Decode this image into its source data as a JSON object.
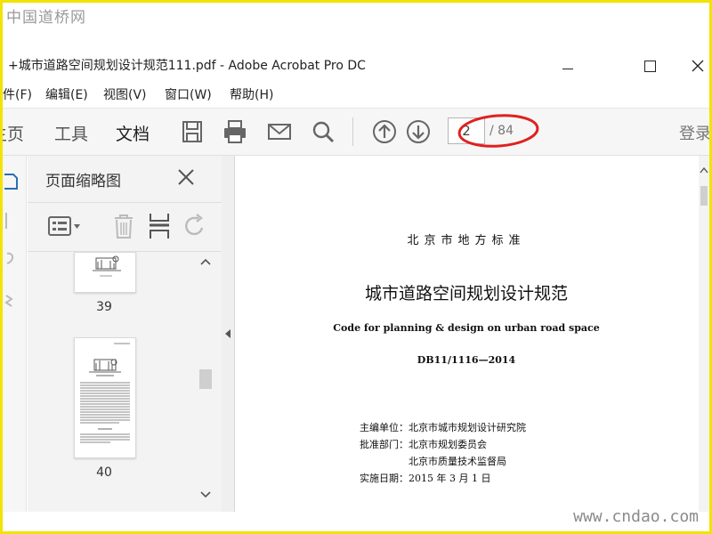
{
  "watermarks": {
    "top": "中国道桥网",
    "bottom": "www.cndao.com"
  },
  "window": {
    "title": "+城市道路空间规划设计规范111.pdf - Adobe Acrobat Pro DC",
    "min": "–",
    "max": "□",
    "close": "✕"
  },
  "menu": [
    "件(F)",
    "编辑(E)",
    "视图(V)",
    "窗口(W)",
    "帮助(H)"
  ],
  "toolbar": {
    "tabs": [
      "主页",
      "工具",
      "文档"
    ],
    "active_tab": "文档",
    "icons": [
      "save-icon",
      "print-icon",
      "email-icon",
      "search-icon",
      "page-up-icon",
      "page-down-icon"
    ],
    "page_current": "2",
    "page_total": "/ 84",
    "login": "登录",
    "highlight_color": "#e02020"
  },
  "panel": {
    "title": "页面缩略图",
    "tools": [
      "thumbnail-options-icon",
      "delete-icon",
      "insert-icon",
      "rotate-icon"
    ],
    "thumbnails": [
      {
        "label": "39"
      },
      {
        "label": "40"
      }
    ]
  },
  "document": {
    "standard_type": "北京市地方标准",
    "title": "城市道路空间规划设计规范",
    "title_en": "Code for planning & design on urban road space",
    "code": "DB11/1116—2014",
    "meta": [
      "主编单位：北京市城市规划设计研究院",
      "批准部门：北京市规划委员会",
      "　　　　　北京市质量技术监督局",
      "实施日期：2015 年 3 月 1 日"
    ]
  }
}
